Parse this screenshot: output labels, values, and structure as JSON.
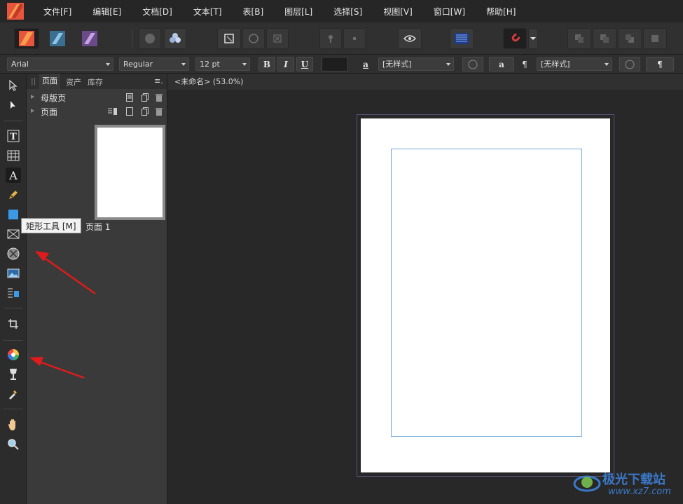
{
  "menubar": {
    "items": [
      "文件[F]",
      "编辑[E]",
      "文档[D]",
      "文本[T]",
      "表[B]",
      "图层[L]",
      "选择[S]",
      "视图[V]",
      "窗口[W]",
      "帮助[H]"
    ]
  },
  "contextbar": {
    "font_family": "Arial",
    "font_style": "Regular",
    "font_size": "12 pt",
    "bold": "B",
    "italic": "I",
    "underline": "U",
    "char_style_icon": "a",
    "char_style": "[无样式]",
    "small_a": "a",
    "pilcrow": "¶",
    "para_style": "[无样式]",
    "pilcrow2": "¶"
  },
  "panel": {
    "tabs": [
      "页面",
      "资产",
      "库存"
    ],
    "master_pages": "母版页",
    "pages": "页面",
    "page_label": "页面 1"
  },
  "document": {
    "tab_title": "<未命名> (53.0%)"
  },
  "tooltip": {
    "text": "矩形工具 [M]"
  },
  "watermark": {
    "name": "极光下载站",
    "url": "www.xz7.com"
  },
  "colors": {
    "accent_arrow": "#e01b1b",
    "margin_guide": "#6fa8d8",
    "app_logo": "#e8553d"
  }
}
